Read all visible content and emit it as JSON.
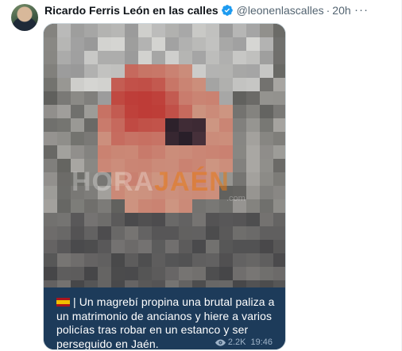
{
  "tweet": {
    "display_name": "Ricardo Ferris León en las calles",
    "handle": "@leonenlascalles",
    "separator": "·",
    "time": "20h",
    "more_label": "···"
  },
  "media": {
    "watermark_main": "HORA",
    "watermark_accent": "JAÉN",
    "watermark_sub": ".com",
    "caption": "| Un magrebí propina una brutal paliza a un matrimonio de ancianos y hiere a varios policías tras robar en un estanco y ser perseguido en Jaén.",
    "views": "2.2K",
    "message_time": "19:46"
  },
  "colors": {
    "caption_bg": "#1d3b5a",
    "verified": "#1d9bf0"
  }
}
